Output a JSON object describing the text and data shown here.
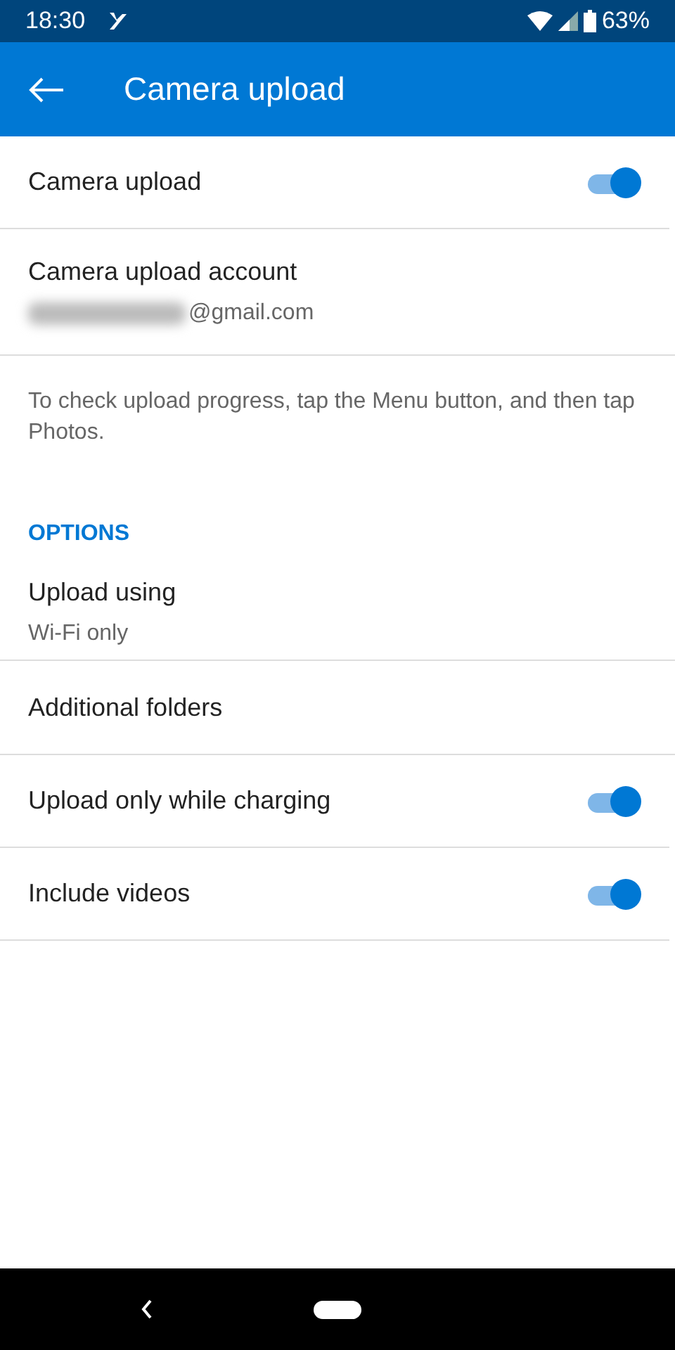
{
  "status_bar": {
    "time": "18:30",
    "battery": "63%"
  },
  "app_bar": {
    "title": "Camera upload"
  },
  "items": [
    {
      "kind": "toggle",
      "label": "Camera upload",
      "on": true
    },
    {
      "kind": "account",
      "label": "Camera upload account",
      "value": "@gmail.com"
    },
    {
      "kind": "info",
      "text": "To check upload progress, tap the Menu button, and then tap Photos."
    },
    {
      "kind": "header",
      "text": "OPTIONS"
    },
    {
      "kind": "detail",
      "label": "Upload using",
      "value": "Wi-Fi only"
    },
    {
      "kind": "plain",
      "label": "Additional folders"
    },
    {
      "kind": "toggle",
      "label": "Upload only while charging",
      "on": true
    },
    {
      "kind": "toggle",
      "label": "Include videos",
      "on": true
    }
  ]
}
